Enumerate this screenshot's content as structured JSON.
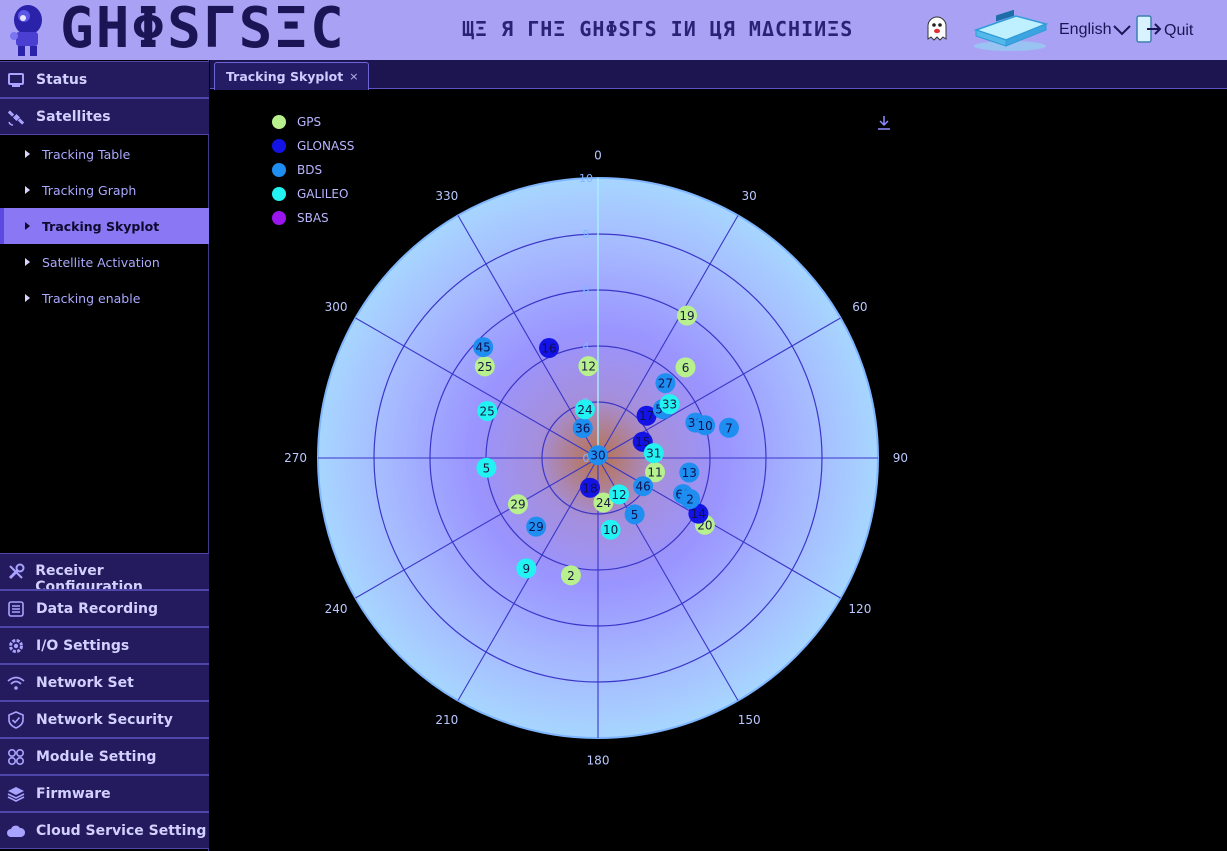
{
  "header": {
    "brand": "GHΦSΓSΞC",
    "tagline": "ЩΞ Я ΓΗΞ GHΦSΓS IИ ЦЯ MΔCHIИΞS",
    "language": "English",
    "quit_label": "Quit"
  },
  "sidebar": {
    "status": "Status",
    "satellites": "Satellites",
    "sub_items": [
      "Tracking Table",
      "Tracking Graph",
      "Tracking Skyplot",
      "Satellite Activation",
      "Tracking enable"
    ],
    "active_sub_item": "Tracking Skyplot",
    "bottom_items": [
      "Receiver Configuration",
      "Data Recording",
      "I/O Settings",
      "Network Set",
      "Network Security",
      "Module Setting",
      "Firmware",
      "Cloud Service Setting"
    ]
  },
  "tabs": {
    "active": "Tracking Skyplot",
    "close_glyph": "×"
  },
  "skyplot": {
    "angular_ticks": [
      0,
      30,
      60,
      90,
      120,
      150,
      180,
      210,
      240,
      270,
      300,
      330
    ],
    "radial_ticks": [
      0,
      2,
      4,
      6,
      8,
      10
    ],
    "radial_max": 10,
    "constellations": [
      {
        "name": "GPS",
        "color": "#b7f08c"
      },
      {
        "name": "GLONASS",
        "color": "#1313e6"
      },
      {
        "name": "BDS",
        "color": "#1e8ef0"
      },
      {
        "name": "GALILEO",
        "color": "#22f2f2"
      },
      {
        "name": "SBAS",
        "color": "#9b16ee"
      }
    ],
    "satellites": [
      {
        "prn": "19",
        "system": "GPS",
        "azimuth": 32,
        "radius": 6.0
      },
      {
        "prn": "6",
        "system": "GPS",
        "azimuth": 44,
        "radius": 4.5
      },
      {
        "prn": "12",
        "system": "GPS",
        "azimuth": 354,
        "radius": 3.3
      },
      {
        "prn": "25",
        "system": "GPS",
        "azimuth": 309,
        "radius": 5.2
      },
      {
        "prn": "11",
        "system": "GPS",
        "azimuth": 104,
        "radius": 2.1
      },
      {
        "prn": "24",
        "system": "GPS",
        "azimuth": 173,
        "radius": 1.6
      },
      {
        "prn": "29",
        "system": "GPS",
        "azimuth": 240,
        "radius": 3.3
      },
      {
        "prn": "2",
        "system": "GPS",
        "azimuth": 193,
        "radius": 4.3
      },
      {
        "prn": "20",
        "system": "GPS",
        "azimuth": 122,
        "radius": 4.5
      },
      {
        "prn": "16",
        "system": "GLONASS",
        "azimuth": 336,
        "radius": 4.3
      },
      {
        "prn": "17",
        "system": "GLONASS",
        "azimuth": 49,
        "radius": 2.3
      },
      {
        "prn": "15",
        "system": "GLONASS",
        "azimuth": 70,
        "radius": 1.7
      },
      {
        "prn": "18",
        "system": "GLONASS",
        "azimuth": 195,
        "radius": 1.1
      },
      {
        "prn": "14",
        "system": "GLONASS",
        "azimuth": 119,
        "radius": 4.1
      },
      {
        "prn": "45",
        "system": "BDS",
        "azimuth": 314,
        "radius": 5.7
      },
      {
        "prn": "27",
        "system": "BDS",
        "azimuth": 42,
        "radius": 3.6
      },
      {
        "prn": "56",
        "system": "BDS",
        "azimuth": 53,
        "radius": 2.9
      },
      {
        "prn": "38",
        "system": "BDS",
        "azimuth": 70,
        "radius": 3.7
      },
      {
        "prn": "10",
        "system": "BDS",
        "azimuth": 73,
        "radius": 4.0
      },
      {
        "prn": "7",
        "system": "BDS",
        "azimuth": 77,
        "radius": 4.8
      },
      {
        "prn": "36",
        "system": "BDS",
        "azimuth": 333,
        "radius": 1.2
      },
      {
        "prn": "30",
        "system": "BDS",
        "azimuth": 0,
        "radius": 0.1
      },
      {
        "prn": "13",
        "system": "BDS",
        "azimuth": 99,
        "radius": 3.3
      },
      {
        "prn": "46",
        "system": "BDS",
        "azimuth": 122,
        "radius": 1.9
      },
      {
        "prn": "60",
        "system": "BDS",
        "azimuth": 113,
        "radius": 3.3
      },
      {
        "prn": "2",
        "system": "BDS",
        "azimuth": 114,
        "radius": 3.6
      },
      {
        "prn": "5",
        "system": "BDS",
        "azimuth": 147,
        "radius": 2.4
      },
      {
        "prn": "29",
        "system": "BDS",
        "azimuth": 222,
        "radius": 3.3
      },
      {
        "prn": "25",
        "system": "GALILEO",
        "azimuth": 293,
        "radius": 4.3
      },
      {
        "prn": "24",
        "system": "GALILEO",
        "azimuth": 345,
        "radius": 1.8
      },
      {
        "prn": "33",
        "system": "GALILEO",
        "azimuth": 53,
        "radius": 3.2
      },
      {
        "prn": "31",
        "system": "GALILEO",
        "azimuth": 85,
        "radius": 2.0
      },
      {
        "prn": "5",
        "system": "GALILEO",
        "azimuth": 265,
        "radius": 4.0
      },
      {
        "prn": "12",
        "system": "GALILEO",
        "azimuth": 150,
        "radius": 1.5
      },
      {
        "prn": "10",
        "system": "GALILEO",
        "azimuth": 170,
        "radius": 2.6
      },
      {
        "prn": "9",
        "system": "GALILEO",
        "azimuth": 213,
        "radius": 4.7
      }
    ]
  }
}
